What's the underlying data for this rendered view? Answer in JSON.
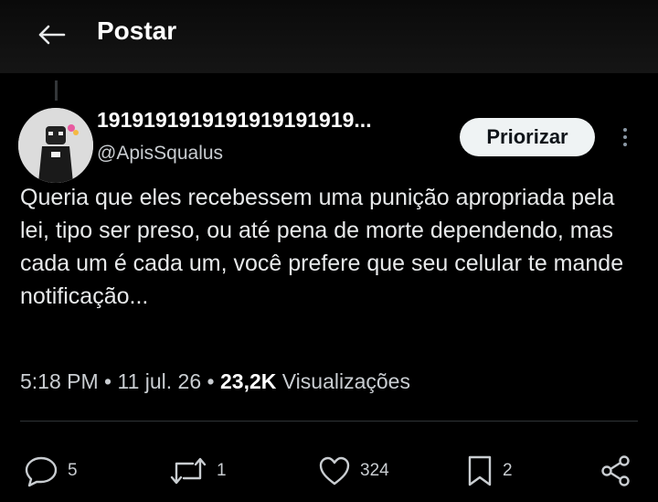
{
  "header": {
    "title": "Postar"
  },
  "tweet": {
    "display_name": "1919191919191919191919...",
    "handle": "@ApisSqualus",
    "priorize_label": "Priorizar",
    "text": "Queria que eles recebessem uma punição apropriada pela lei, tipo ser preso, ou até pena de morte dependendo, mas cada um é cada um, você prefere que seu celular te mande notificação...",
    "time": "5:18 PM",
    "date": "11 jul. 26",
    "views_count": "23,2K",
    "views_label": "Visualizações"
  },
  "actions": {
    "replies": "5",
    "retweets": "1",
    "likes": "324",
    "bookmarks": "2"
  },
  "colors": {
    "background": "#000000",
    "text": "#e7e9ea",
    "muted": "#c9cdd1",
    "button_bg": "#eff3f4"
  }
}
